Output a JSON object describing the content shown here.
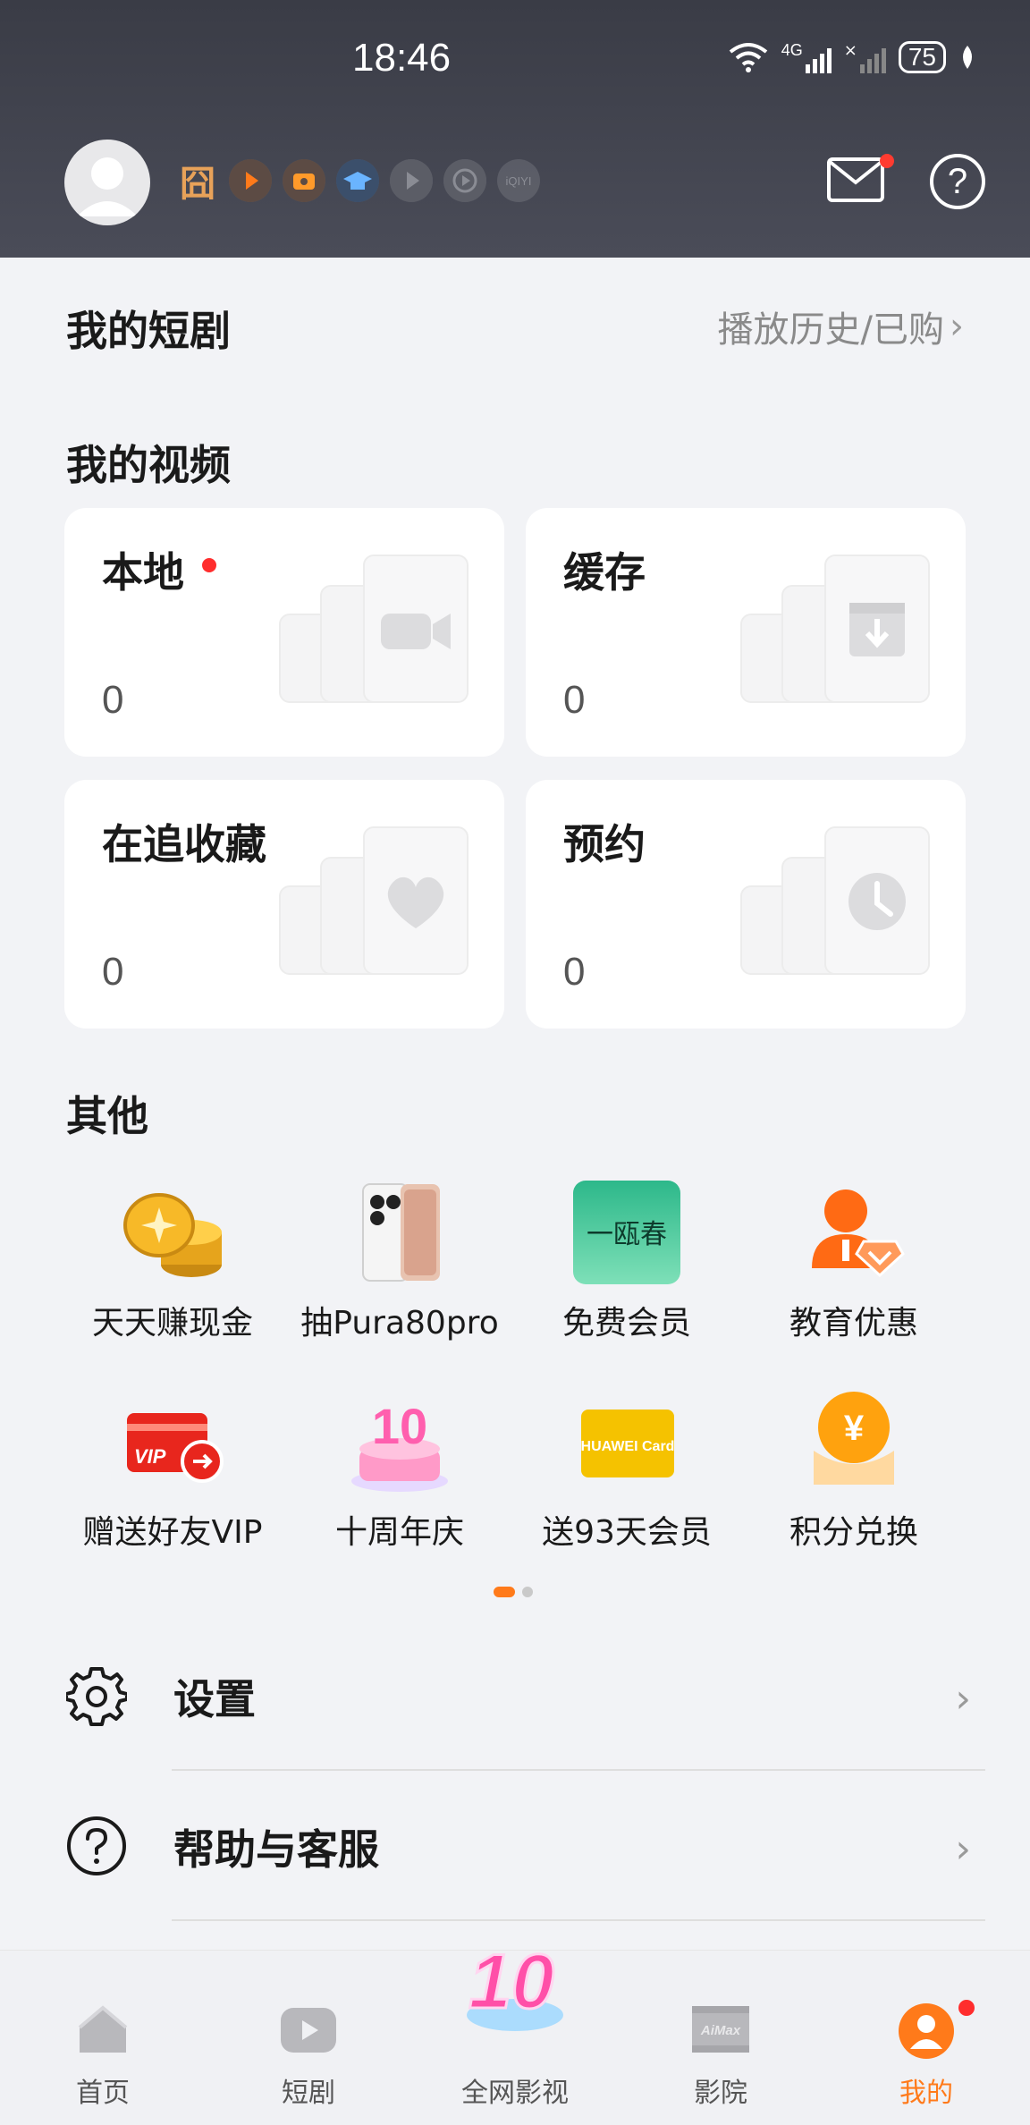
{
  "status_bar": {
    "time": "18:46",
    "battery": "75",
    "network": "4G"
  },
  "header": {
    "member_badge": "囧",
    "member_icons": [
      "play-badge-icon",
      "tv-badge-icon",
      "education-badge-icon",
      "video-badge-icon",
      "film-badge-icon",
      "iqiyi-badge-icon"
    ],
    "iqiyi_label": "iQIYI"
  },
  "short_drama": {
    "title": "我的短剧",
    "history_link": "播放历史/已购"
  },
  "my_videos": {
    "title": "我的视频",
    "cards": [
      {
        "label": "本地",
        "count": "0",
        "has_dot": true,
        "icon": "video-camera-icon"
      },
      {
        "label": "缓存",
        "count": "0",
        "has_dot": false,
        "icon": "download-box-icon"
      },
      {
        "label": "在追收藏",
        "count": "0",
        "has_dot": false,
        "icon": "heart-icon"
      },
      {
        "label": "预约",
        "count": "0",
        "has_dot": false,
        "icon": "clock-icon"
      }
    ]
  },
  "others": {
    "title": "其他",
    "items": [
      {
        "label": "天天赚现金",
        "icon": "gold-coins-icon"
      },
      {
        "label": "抽Pura80pro",
        "icon": "phone-icon"
      },
      {
        "label": "免费会员",
        "icon": "free-member-icon",
        "icon_text": "一瓯春"
      },
      {
        "label": "教育优惠",
        "icon": "education-discount-icon"
      },
      {
        "label": "赠送好友VIP",
        "icon": "vip-card-icon",
        "icon_text": "VIP"
      },
      {
        "label": "十周年庆",
        "icon": "anniversary-cake-icon",
        "icon_text": "10"
      },
      {
        "label": "送93天会员",
        "icon": "huawei-card-icon",
        "icon_text": "HUAWEI Card"
      },
      {
        "label": "积分兑换",
        "icon": "points-exchange-icon",
        "icon_text": "¥"
      }
    ],
    "page_index": 1,
    "page_count": 2
  },
  "menu": [
    {
      "label": "设置",
      "icon": "gear-icon"
    },
    {
      "label": "帮助与客服",
      "icon": "help-circle-icon"
    }
  ],
  "bottom_nav": {
    "items": [
      {
        "label": "首页",
        "icon": "home-icon",
        "active": false
      },
      {
        "label": "短剧",
        "icon": "short-drama-icon",
        "active": false
      },
      {
        "label": "全网影视",
        "icon": "tenth-anniversary-icon",
        "active": false,
        "icon_text": "10"
      },
      {
        "label": "影院",
        "icon": "aimax-icon",
        "active": false,
        "icon_text": "AiMax"
      },
      {
        "label": "我的",
        "icon": "profile-icon",
        "active": true,
        "has_dot": true
      }
    ]
  },
  "colors": {
    "accent": "#ff7a1a",
    "header_bg": "#3a3c46",
    "page_bg": "#f2f3f6",
    "notification_red": "#ff2d2d"
  }
}
